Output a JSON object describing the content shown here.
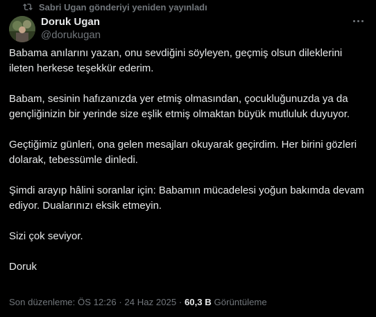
{
  "repost": {
    "text": "Sabri Ugan gönderiyi yeniden yayınladı",
    "icon": "repost-icon"
  },
  "author": {
    "display_name": "Doruk Ugan",
    "handle": "@dorukugan"
  },
  "more_menu": {
    "icon": "more-horizontal-icon"
  },
  "tweet": {
    "paragraphs": [
      "Babama anılarını yazan, onu sevdiğini söyleyen, geçmiş olsun dileklerini ileten herkese teşekkür ederim.",
      "Babam, sesinin hafızanızda yer etmiş olmasından, çocukluğunuzda ya da gençliğinizin bir yerinde size eşlik etmiş olmaktan büyük mutluluk duyuyor.",
      "Geçtiğimiz günleri, ona gelen mesajları okuyarak geçirdim. Her birini gözleri dolarak, tebessümle dinledi.",
      "Şimdi arayıp hâlini soranlar için: Babamın mücadelesi yoğun bakımda devam ediyor. Dualarınızı eksik etmeyin.",
      "Sizi çok seviyor.",
      "Doruk"
    ]
  },
  "meta": {
    "edited_label": "Son düzenleme: ÖS 12:26",
    "separator_1": " · ",
    "date": "24 Haz 2025",
    "separator_2": " · ",
    "views_count": "60,3 B",
    "views_label": " Görüntüleme"
  },
  "colors": {
    "background": "#000000",
    "text": "#e7e9ea",
    "secondary": "#71767b"
  }
}
